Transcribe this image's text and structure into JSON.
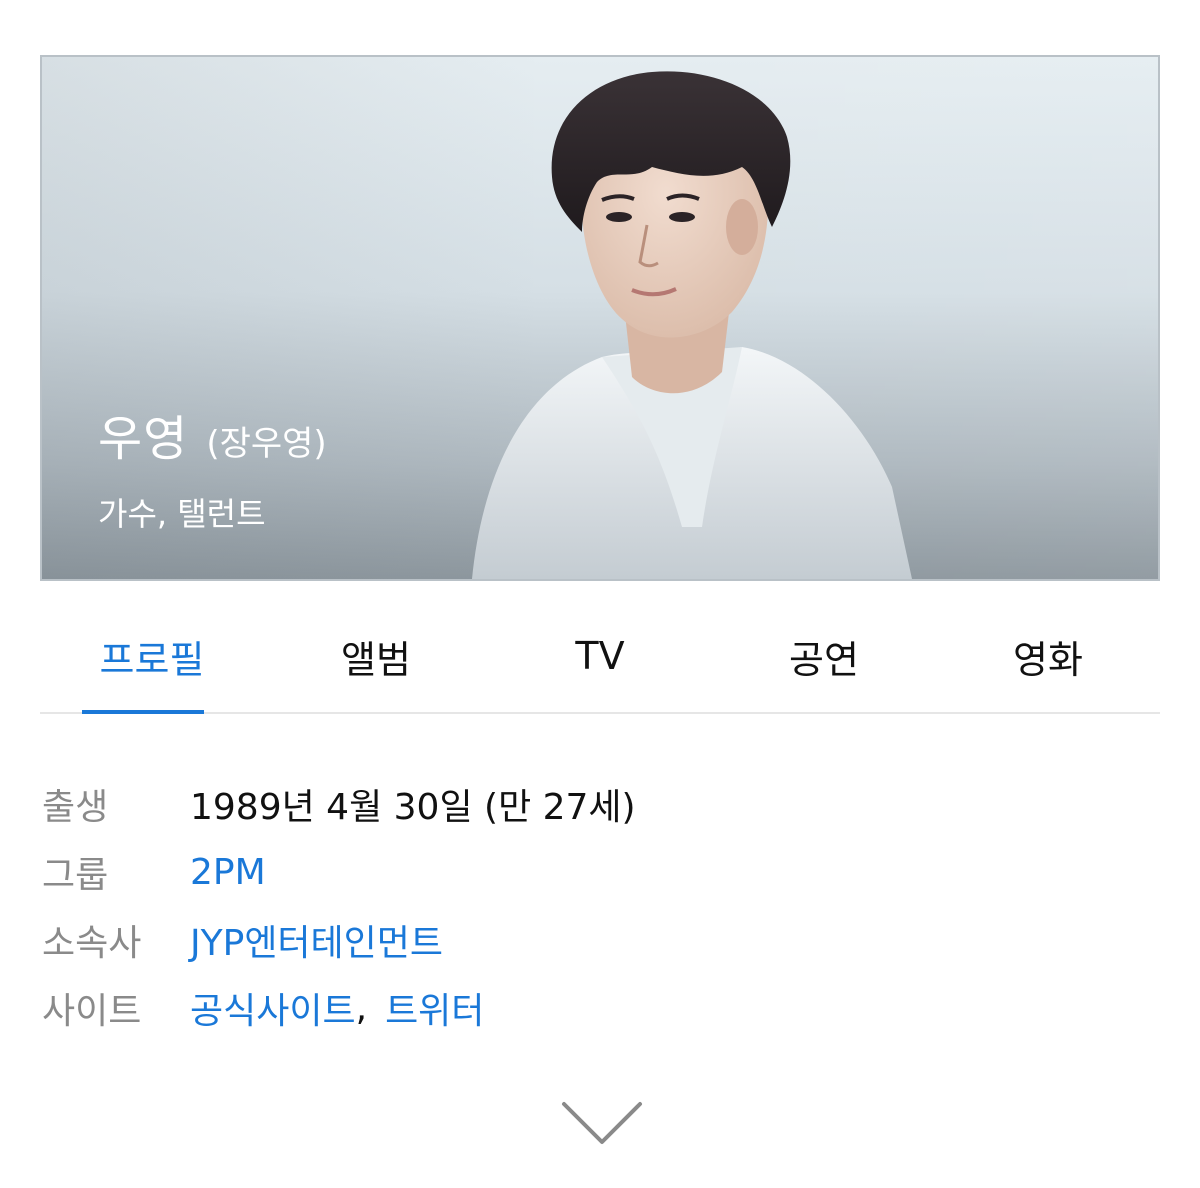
{
  "hero": {
    "name": "우영",
    "real_name": "(장우영)",
    "roles": "가수, 탤런트"
  },
  "tabs": [
    {
      "label": "프로필",
      "active": true
    },
    {
      "label": "앨범",
      "active": false
    },
    {
      "label": "TV",
      "active": false
    },
    {
      "label": "공연",
      "active": false
    },
    {
      "label": "영화",
      "active": false
    }
  ],
  "profile": {
    "birth": {
      "label": "출생",
      "value": "1989년 4월 30일 (만 27세)"
    },
    "group": {
      "label": "그룹",
      "value": "2PM"
    },
    "agency": {
      "label": "소속사",
      "value": "JYP엔터테인먼트"
    },
    "site": {
      "label": "사이트",
      "links": [
        "공식사이트",
        "트위터"
      ],
      "separator": ","
    }
  },
  "icons": {
    "expand": "chevron-down-icon"
  },
  "colors": {
    "accent": "#1a78d8",
    "label_gray": "#8a8a8a",
    "text": "#111111"
  }
}
